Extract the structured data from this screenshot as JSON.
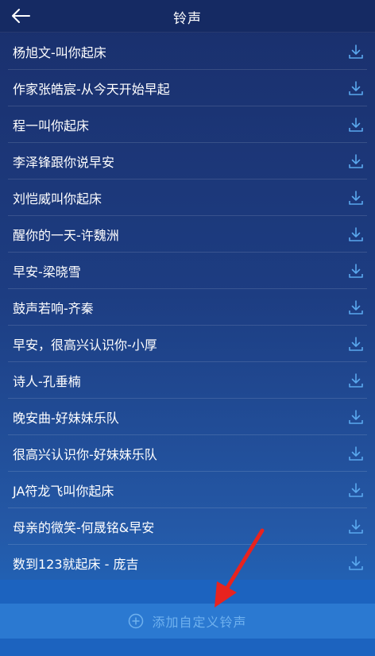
{
  "header": {
    "title": "铃声",
    "back_icon": "back-arrow-icon"
  },
  "ringtones": [
    {
      "label": "杨旭文-叫你起床"
    },
    {
      "label": "作家张皓宸-从今天开始早起"
    },
    {
      "label": "程一叫你起床"
    },
    {
      "label": "李泽锋跟你说早安"
    },
    {
      "label": "刘恺威叫你起床"
    },
    {
      "label": "醒你的一天-许魏洲"
    },
    {
      "label": "早安-梁晓雪"
    },
    {
      "label": "鼓声若响-齐秦"
    },
    {
      "label": "早安，很高兴认识你-小厚"
    },
    {
      "label": "诗人-孔垂楠"
    },
    {
      "label": "晚安曲-好妹妹乐队"
    },
    {
      "label": "很高兴认识你-好妹妹乐队"
    },
    {
      "label": "JA符龙飞叫你起床"
    },
    {
      "label": "母亲的微笑-何晟铭&早安"
    },
    {
      "label": "数到123就起床 - 庞吉"
    }
  ],
  "download_icon": "download-icon",
  "add_custom": {
    "label": "添加自定义铃声",
    "icon": "plus-circle-icon"
  },
  "annotation": {
    "icon": "red-arrow-annotation",
    "color": "#e8231f"
  },
  "colors": {
    "header_bg": "#152a63",
    "list_text": "#ffffff",
    "download_icon": "#5aa8ee",
    "add_bar_bg": "#2b79d1",
    "add_text": "#6fb1ee"
  }
}
